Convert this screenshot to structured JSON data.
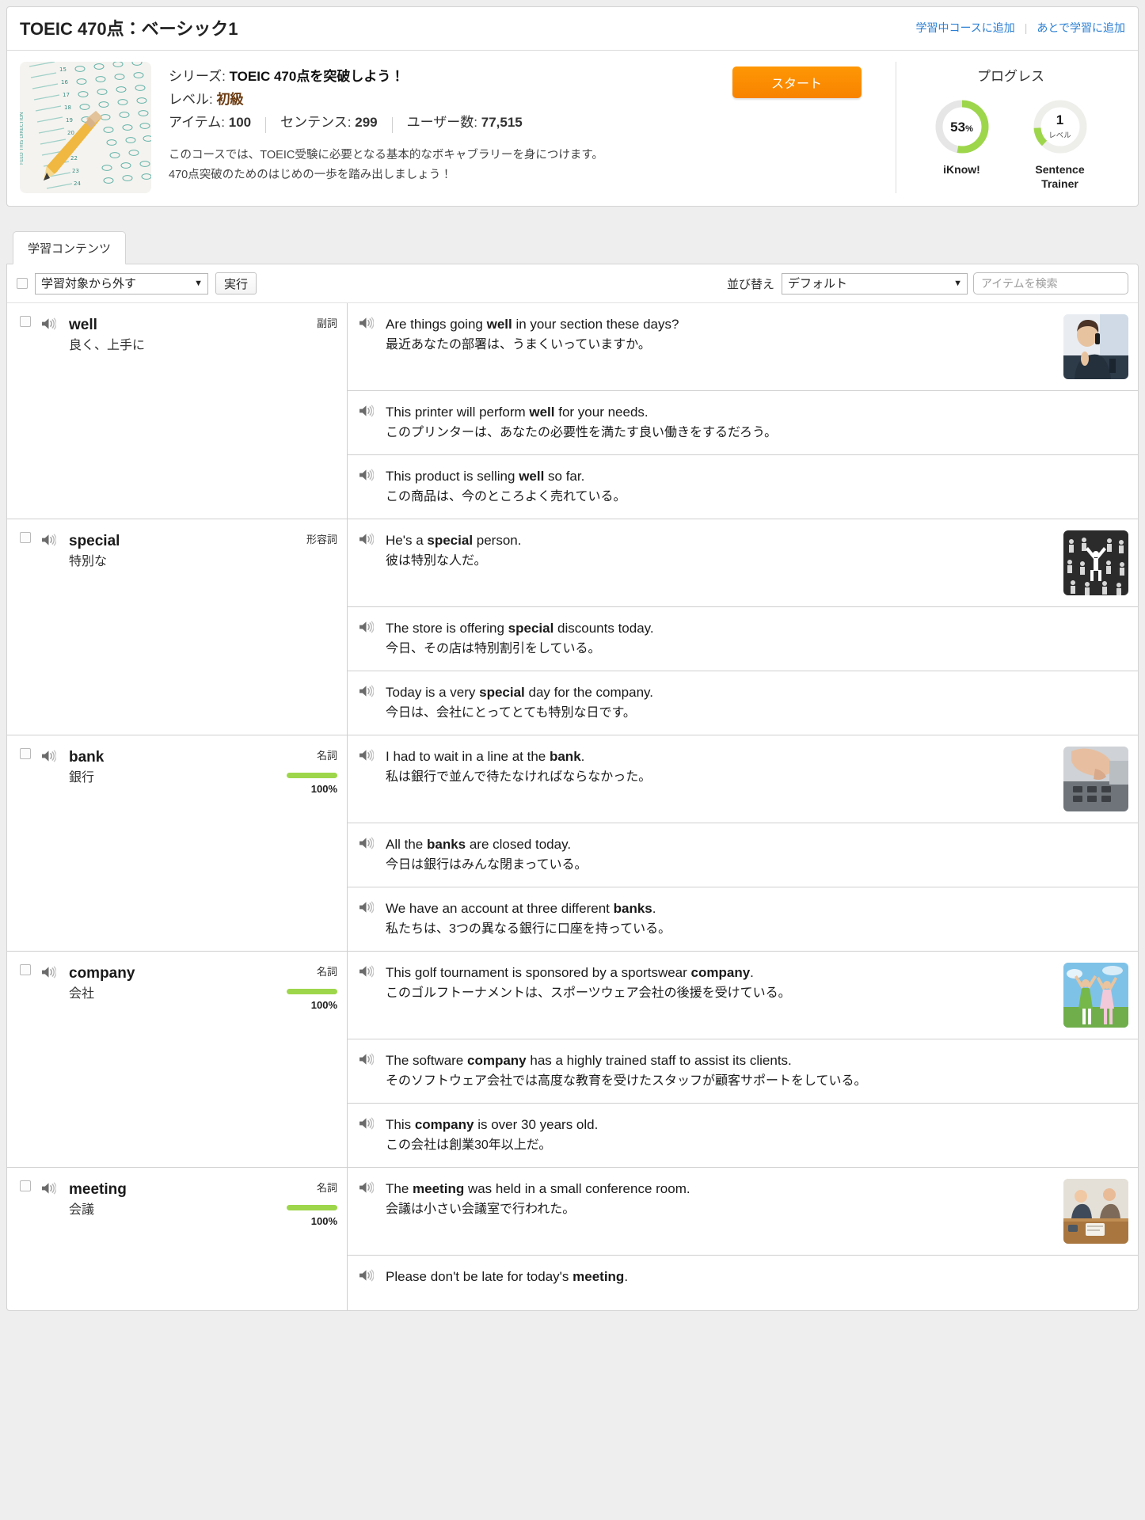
{
  "header": {
    "course_title": "TOEIC 470点：ベーシック1",
    "link_add_studying": "学習中コースに追加",
    "link_add_later": "あとで学習に追加",
    "separator": "|"
  },
  "course": {
    "series_label": "シリーズ:",
    "series_value": "TOEIC 470点を突破しよう！",
    "level_label": "レベル:",
    "level_value": "初級",
    "items_label": "アイテム:",
    "items_value": "100",
    "sentences_label": "センテンス:",
    "sentences_value": "299",
    "users_label": "ユーザー数:",
    "users_value": "77,515",
    "description_line1": "このコースでは、TOEIC受験に必要となる基本的なボキャブラリーを身につけます。",
    "description_line2": "470点突破のためのはじめの一歩を踏み出しましょう！",
    "start_button": "スタート",
    "thumb_icon": "answer-sheet-pencil-image"
  },
  "progress": {
    "title": "プログレス",
    "iknow": {
      "value": "53",
      "unit": "%",
      "percent": 53,
      "label": "iKnow!"
    },
    "sentence_trainer": {
      "value": "1",
      "sub": "レベル",
      "percent": 12,
      "label_line1": "Sentence",
      "label_line2": "Trainer"
    },
    "ring_color": "#9ed64b",
    "ring_track_color": "#e6e6e6"
  },
  "tabs": [
    {
      "label": "学習コンテンツ",
      "active": true
    }
  ],
  "toolbar": {
    "bulk_select_checkbox": "",
    "bulk_action_selected": "学習対象から外す",
    "bulk_action_caret": "▼",
    "execute_button": "実行",
    "sort_label": "並び替え",
    "sort_selected": "デフォルト",
    "sort_caret": "▼",
    "search_placeholder": "アイテムを検索",
    "search_value": ""
  },
  "icons": {
    "speaker": "speaker-icon",
    "caret_down": "chevron-down-icon"
  },
  "items": [
    {
      "word_en": "well",
      "word_ja": "良く、上手に",
      "pos": "副詞",
      "mastery": null,
      "mastery_pct_label": null,
      "sentences": [
        {
          "en_pre": "Are things going ",
          "en_bold": "well",
          "en_post": " in your section these days?",
          "ja": "最近あなたの部署は、うまくいっていますか。",
          "thumb": "businesswoman-on-phone-image"
        },
        {
          "en_pre": "This printer will perform ",
          "en_bold": "well",
          "en_post": " for your needs.",
          "ja": "このプリンターは、あなたの必要性を満たす良い働きをするだろう。",
          "thumb": null
        },
        {
          "en_pre": "This product is selling ",
          "en_bold": "well",
          "en_post": " so far.",
          "ja": "この商品は、今のところよく売れている。",
          "thumb": null
        }
      ]
    },
    {
      "word_en": "special",
      "word_ja": "特別な",
      "pos": "形容詞",
      "mastery": null,
      "mastery_pct_label": null,
      "sentences": [
        {
          "en_pre": "He's a ",
          "en_bold": "special",
          "en_post": " person.",
          "ja": "彼は特別な人だ。",
          "thumb": "crowd-standout-image"
        },
        {
          "en_pre": "The store is offering ",
          "en_bold": "special",
          "en_post": " discounts today.",
          "ja": "今日、その店は特別割引をしている。",
          "thumb": null
        },
        {
          "en_pre": "Today is a very ",
          "en_bold": "special",
          "en_post": " day for the company.",
          "ja": "今日は、会社にとってとても特別な日です。",
          "thumb": null
        }
      ]
    },
    {
      "word_en": "bank",
      "word_ja": "銀行",
      "pos": "名詞",
      "mastery": 100,
      "mastery_pct_label": "100%",
      "sentences": [
        {
          "en_pre": "I had to wait in a line at the ",
          "en_bold": "bank",
          "en_post": ".",
          "ja": "私は銀行で並んで待たなければならなかった。",
          "thumb": "atm-keypad-image"
        },
        {
          "en_pre": "All the ",
          "en_bold": "banks",
          "en_post": " are closed today.",
          "ja": "今日は銀行はみんな閉まっている。",
          "thumb": null
        },
        {
          "en_pre": "We have an account at three different ",
          "en_bold": "banks",
          "en_post": ".",
          "ja": "私たちは、3つの異なる銀行に口座を持っている。",
          "thumb": null
        }
      ]
    },
    {
      "word_en": "company",
      "word_ja": "会社",
      "pos": "名詞",
      "mastery": 100,
      "mastery_pct_label": "100%",
      "sentences": [
        {
          "en_pre": "This golf tournament is sponsored by a sportswear ",
          "en_bold": "company",
          "en_post": ".",
          "ja": "このゴルフトーナメントは、スポーツウェア会社の後援を受けている。",
          "thumb": "golf-celebration-image"
        },
        {
          "en_pre": "The software ",
          "en_bold": "company",
          "en_post": " has a highly trained staff to assist its clients.",
          "ja": "そのソフトウェア会社では高度な教育を受けたスタッフが顧客サポートをしている。",
          "thumb": null
        },
        {
          "en_pre": "This ",
          "en_bold": "company",
          "en_post": " is over 30 years old.",
          "ja": "この会社は創業30年以上だ。",
          "thumb": null
        }
      ]
    },
    {
      "word_en": "meeting",
      "word_ja": "会議",
      "pos": "名詞",
      "mastery": 100,
      "mastery_pct_label": "100%",
      "sentences": [
        {
          "en_pre": "The ",
          "en_bold": "meeting",
          "en_post": " was held in a small conference room.",
          "ja": "会議は小さい会議室で行われた。",
          "thumb": "meeting-table-image"
        },
        {
          "en_pre": "Please don't be late for today's ",
          "en_bold": "meeting",
          "en_post": ".",
          "ja": "",
          "thumb": null
        }
      ]
    }
  ],
  "colors": {
    "accent_orange": "#f98b00",
    "link_blue": "#2a7fd4",
    "green": "#9ed64b",
    "page_bg": "#eeeeee"
  }
}
